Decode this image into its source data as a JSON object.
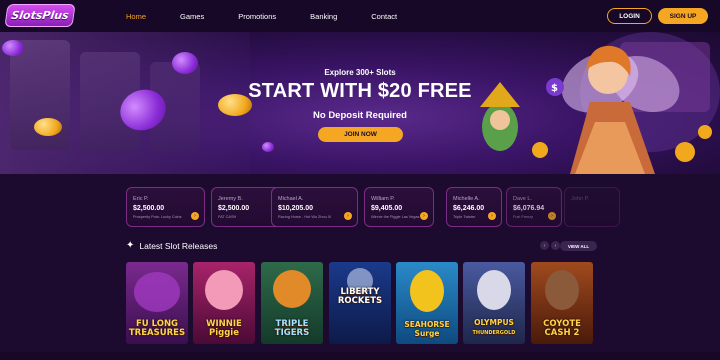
{
  "header": {
    "logo_text": "SlotsPlus",
    "nav": [
      "Home",
      "Games",
      "Promotions",
      "Banking",
      "Contact"
    ],
    "login_label": "LOGIN",
    "signup_label": "SIGN UP",
    "accent_color": "#f5a623"
  },
  "hero": {
    "subtitle": "Explore 300+ Slots",
    "title": "START WITH $20 FREE",
    "no_deposit": "No Deposit Required",
    "join_label": "JOIN NOW"
  },
  "winners": [
    {
      "name": "Eric P.",
      "amount": "$2,500.00",
      "game": "Prosperity Pots: Lucky Coins"
    },
    {
      "name": "Jeremy B.",
      "amount": "$2,500.00",
      "game": "FAT CASH"
    },
    {
      "name": "Michael A.",
      "amount": "$10,205.00",
      "game": "Racing Horse - Hot Wo Zhou Xi"
    },
    {
      "name": "William P.",
      "amount": "$9,405.00",
      "game": "Winnie the Piggie Las Vegas"
    },
    {
      "name": "Michelle A.",
      "amount": "$6,246.00",
      "game": "Triple Twister"
    },
    {
      "name": "Dave L.",
      "amount": "$6,076.94",
      "game": "Fuel Frenzy"
    },
    {
      "name": "John P.",
      "amount": "",
      "game": ""
    }
  ],
  "releases": {
    "title": "Latest Slot Releases",
    "prev_icon": "‹",
    "next_icon": "›",
    "view_all_label": "VIEW ALL",
    "games": [
      {
        "name": "FU LONG TREASURES",
        "line1": "FU LONG",
        "line2": "TREASURES",
        "bg": "#5a1a6e"
      },
      {
        "name": "WINNIE THE PIGGIE",
        "line1": "WINNIE",
        "line2": "Piggie",
        "bg": "#8a1a5c"
      },
      {
        "name": "TRIPLE TIGERS",
        "line1": "TRIPLE",
        "line2": "TIGERS",
        "bg": "#1e4a3a"
      },
      {
        "name": "LIBERTY ROCKETS",
        "line1": "LIBERTY",
        "line2": "ROCKETS",
        "bg": "#142a6a"
      },
      {
        "name": "SEAHORSE SURGE",
        "line1": "SEAHORSE",
        "line2": "Surge",
        "bg": "#1a6aa0"
      },
      {
        "name": "OLYMPUS THUNDERGOLD",
        "line1": "OLYMPUS",
        "line2": "THUNDERGOLD",
        "bg": "#3a4a8a"
      },
      {
        "name": "COYOTE CASH 2",
        "line1": "COYOTE",
        "line2": "CASH 2",
        "bg": "#7a3a1a"
      }
    ]
  }
}
